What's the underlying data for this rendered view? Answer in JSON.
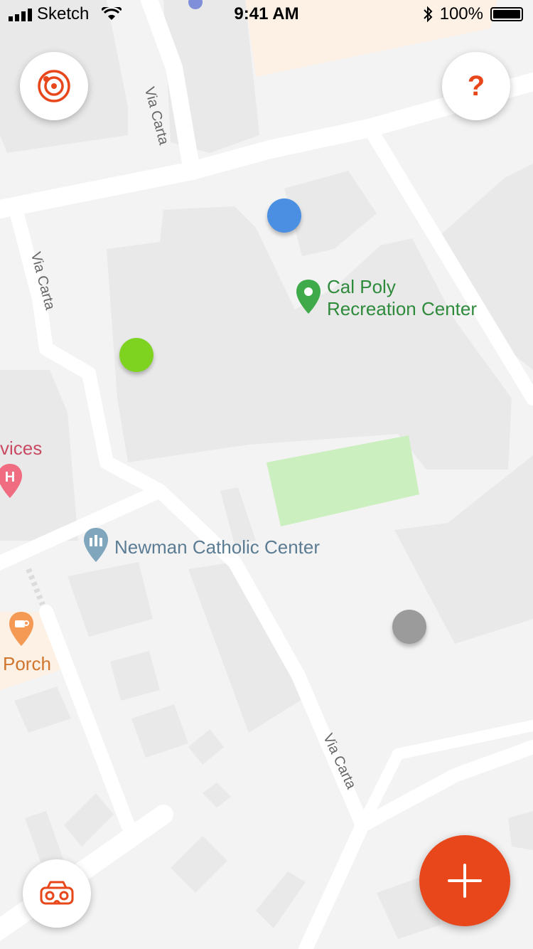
{
  "status_bar": {
    "carrier": "Sketch",
    "time": "9:41 AM",
    "battery": "100%"
  },
  "map": {
    "streets": [
      "Via Carta",
      "Via Carta",
      "Via Carta"
    ],
    "places": [
      {
        "name_line1": "Cal Poly",
        "name_line2": "Recreation Center",
        "icon": "map-pin-icon"
      },
      {
        "name": "Newman Catholic Center",
        "icon": "church-icon"
      },
      {
        "name": "vices",
        "icon": "hospital-icon"
      },
      {
        "name": "Porch",
        "icon": "coffee-icon"
      }
    ],
    "markers": [
      {
        "name": "blue-location-dot",
        "color": "#4a8fe2"
      },
      {
        "name": "green-location-dot",
        "color": "#7ed321"
      },
      {
        "name": "gray-location-dot",
        "color": "#9b9b9b"
      }
    ]
  },
  "buttons": {
    "radar": {
      "icon": "radar-icon",
      "color": "#e8461b"
    },
    "help": {
      "icon": "question-icon",
      "label": "?",
      "color": "#e8461b"
    },
    "vr": {
      "icon": "vr-headset-icon",
      "color": "#e8461b"
    },
    "add": {
      "icon": "plus-icon",
      "color": "#e8461b"
    }
  }
}
